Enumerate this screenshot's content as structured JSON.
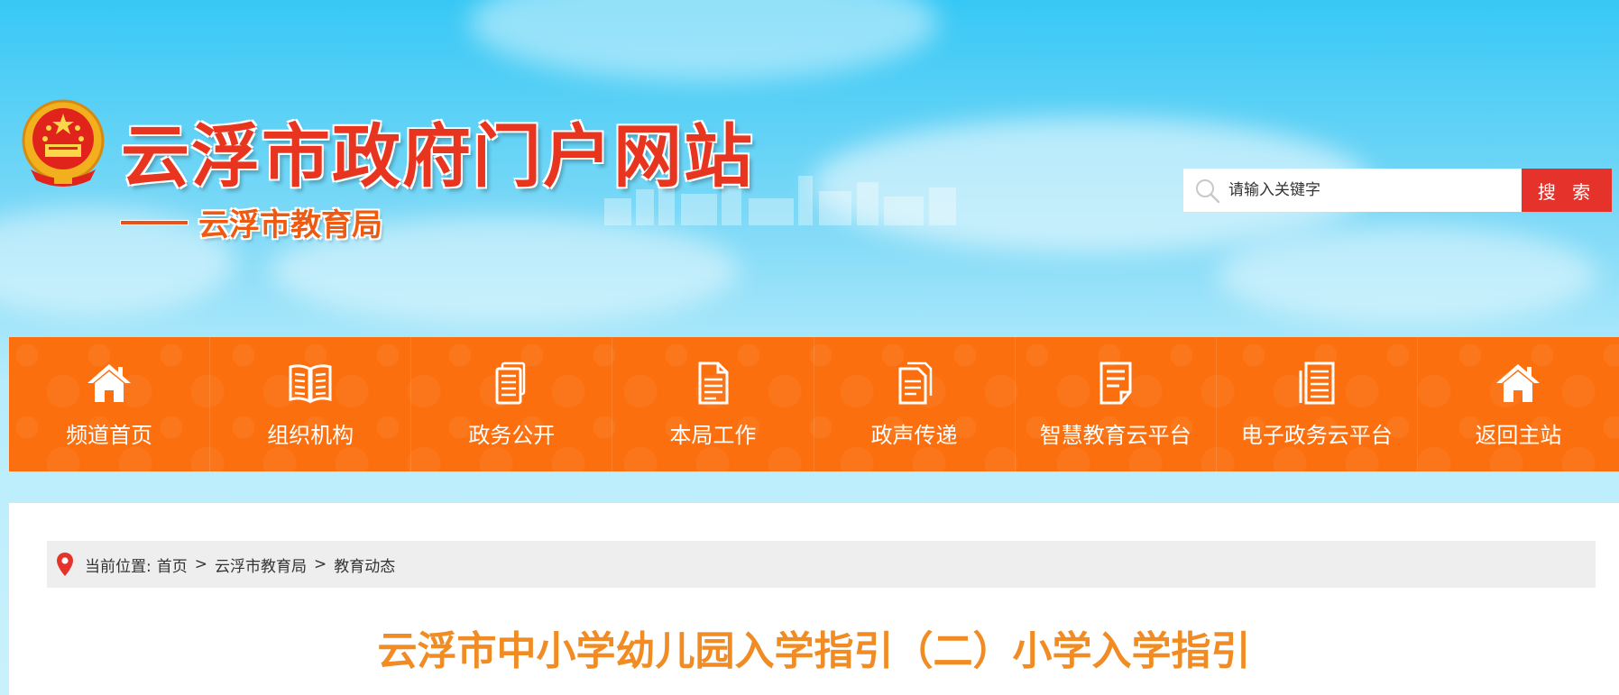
{
  "header": {
    "site_title": "云浮市政府门户网站",
    "sub_title": "云浮市教育局",
    "emblem_icon": "national-emblem-icon"
  },
  "search": {
    "placeholder": "请输入关键字",
    "button_label": "搜 索",
    "button_color": "#e5332b"
  },
  "nav": {
    "background_color": "#fb6f0e",
    "items": [
      {
        "label": "频道首页",
        "icon": "home-icon"
      },
      {
        "label": "组织机构",
        "icon": "book-icon"
      },
      {
        "label": "政务公开",
        "icon": "document-stack-icon"
      },
      {
        "label": "本局工作",
        "icon": "file-icon"
      },
      {
        "label": "政声传递",
        "icon": "files-icon"
      },
      {
        "label": "智慧教育云平台",
        "icon": "notepad-icon"
      },
      {
        "label": "电子政务云平台",
        "icon": "list-document-icon"
      },
      {
        "label": "返回主站",
        "icon": "home-icon"
      }
    ]
  },
  "breadcrumb": {
    "prefix": "当前位置:",
    "items": [
      "首页",
      "云浮市教育局",
      "教育动态"
    ],
    "separator": ">"
  },
  "article": {
    "title": "云浮市中小学幼儿园入学指引（二）小学入学指引",
    "title_color": "#f08c23"
  }
}
